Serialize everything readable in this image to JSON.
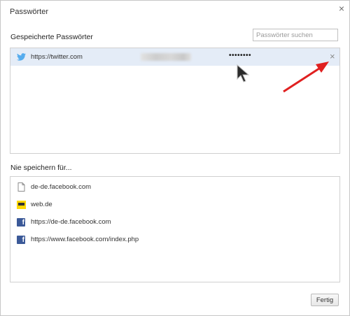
{
  "window": {
    "title": "Passwörter",
    "close_glyph": "×"
  },
  "saved": {
    "heading": "Gespeicherte Passwörter",
    "search_placeholder": "Passwörter suchen",
    "rows": [
      {
        "site": "https://twitter.com",
        "icon": "twitter-icon",
        "password_masked": "••••••••",
        "remove_glyph": "×"
      }
    ]
  },
  "never": {
    "heading": "Nie speichern für...",
    "items": [
      {
        "site": "de-de.facebook.com",
        "icon": "page-icon"
      },
      {
        "site": "web.de",
        "icon": "webde-icon"
      },
      {
        "site": "https://de-de.facebook.com",
        "icon": "facebook-icon"
      },
      {
        "site": "https://www.facebook.com/index.php",
        "icon": "facebook-icon"
      }
    ]
  },
  "footer": {
    "done_label": "Fertig"
  },
  "colors": {
    "selected_row": "#e4ecf7",
    "twitter": "#55acee",
    "facebook": "#3b5998",
    "arrow": "#e02020"
  }
}
